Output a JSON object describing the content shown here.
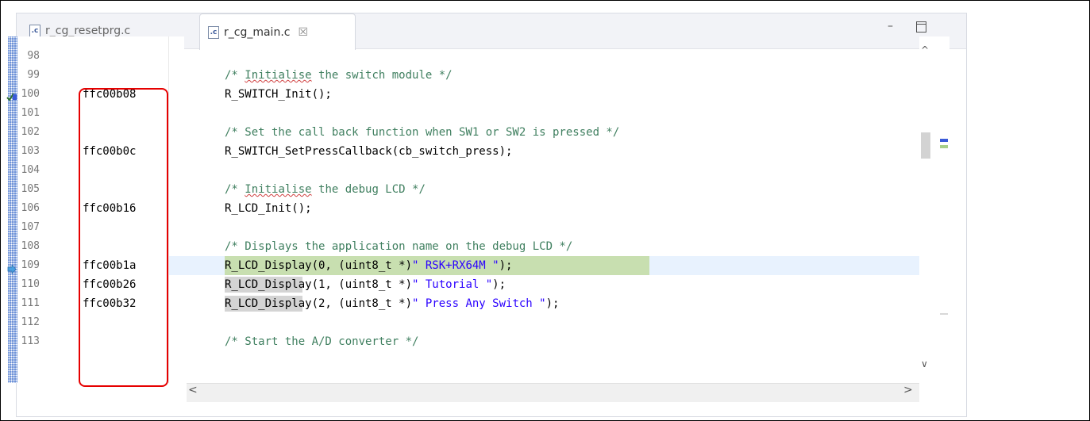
{
  "tabs": [
    {
      "icon": ".c",
      "label": "r_cg_resetprg.c"
    },
    {
      "icon": ".c",
      "label": "r_cg_main.c",
      "close": "☒"
    }
  ],
  "window": {
    "minimize": "–",
    "scroll_up": "^",
    "scroll_down": "∨",
    "scroll_left": "<",
    "scroll_right": ">"
  },
  "lines": [
    {
      "num": "98",
      "addr": "",
      "code": ""
    },
    {
      "num": "99",
      "addr": "",
      "code": "/* Initialise the switch module */"
    },
    {
      "num": "100",
      "addr": "ffc00b08",
      "code": "R_SWITCH_Init();"
    },
    {
      "num": "101",
      "addr": "",
      "code": ""
    },
    {
      "num": "102",
      "addr": "",
      "code": "/* Set the call back function when SW1 or SW2 is pressed */"
    },
    {
      "num": "103",
      "addr": "ffc00b0c",
      "code": "R_SWITCH_SetPressCallback(cb_switch_press);"
    },
    {
      "num": "104",
      "addr": "",
      "code": ""
    },
    {
      "num": "105",
      "addr": "",
      "code": "/* Initialise the debug LCD */"
    },
    {
      "num": "106",
      "addr": "ffc00b16",
      "code": "R_LCD_Init();"
    },
    {
      "num": "107",
      "addr": "",
      "code": ""
    },
    {
      "num": "108",
      "addr": "",
      "code": "/* Displays the application name on the debug LCD */"
    },
    {
      "num": "109",
      "addr": "ffc00b1a",
      "code": "R_LCD_Display(0, (uint8_t *)\" RSK+RX64M \");"
    },
    {
      "num": "110",
      "addr": "ffc00b26",
      "code": "R_LCD_Display(1, (uint8_t *)\" Tutorial \");"
    },
    {
      "num": "111",
      "addr": "ffc00b32",
      "code": "R_LCD_Display(2, (uint8_t *)\" Press Any Switch \");"
    },
    {
      "num": "112",
      "addr": "",
      "code": ""
    },
    {
      "num": "113",
      "addr": "",
      "code": "/* Start the A/D converter */"
    }
  ],
  "markers": {
    "breakpoint_line": "100",
    "current_line": "109"
  },
  "colors": {
    "comment": "#3f7f5f",
    "string": "#2a00ff",
    "current_line_bg": "#c8dfb0",
    "annotation_box": "#e60000"
  }
}
